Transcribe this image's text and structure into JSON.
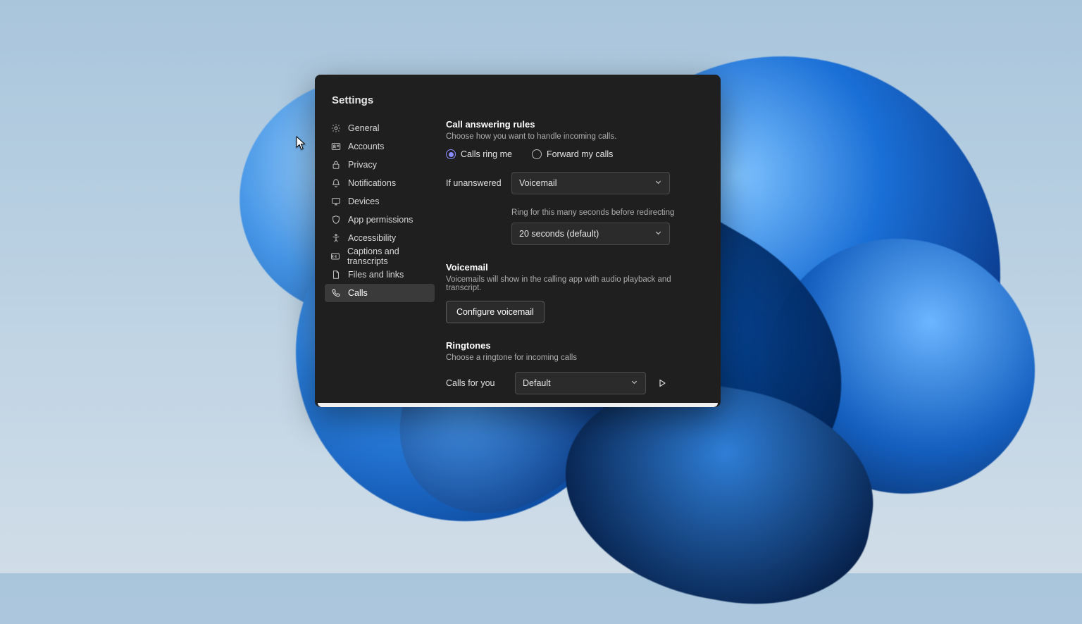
{
  "window": {
    "title": "Settings"
  },
  "sidebar": {
    "items": [
      {
        "label": "General"
      },
      {
        "label": "Accounts"
      },
      {
        "label": "Privacy"
      },
      {
        "label": "Notifications"
      },
      {
        "label": "Devices"
      },
      {
        "label": "App permissions"
      },
      {
        "label": "Accessibility"
      },
      {
        "label": "Captions and transcripts"
      },
      {
        "label": "Files and links"
      },
      {
        "label": "Calls"
      }
    ]
  },
  "calls": {
    "answering": {
      "title": "Call answering rules",
      "desc": "Choose how you want to handle incoming calls.",
      "radio_ring": "Calls ring me",
      "radio_forward": "Forward my calls",
      "if_unanswered_label": "If unanswered",
      "if_unanswered_value": "Voicemail",
      "ring_duration_label": "Ring for this many seconds before redirecting",
      "ring_duration_value": "20 seconds (default)"
    },
    "voicemail": {
      "title": "Voicemail",
      "desc": "Voicemails will show in the calling app with audio playback and transcript.",
      "button": "Configure voicemail"
    },
    "ringtones": {
      "title": "Ringtones",
      "desc": "Choose a ringtone for incoming calls",
      "calls_for_you_label": "Calls for you",
      "calls_for_you_value": "Default"
    }
  }
}
